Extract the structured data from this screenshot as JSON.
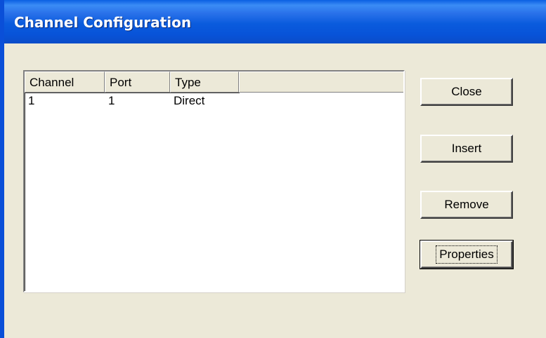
{
  "window": {
    "title": "Channel Configuration"
  },
  "list": {
    "columns": [
      "Channel",
      "Port",
      "Type"
    ],
    "rows": [
      {
        "channel": "1",
        "port": "1",
        "type": "Direct"
      }
    ]
  },
  "buttons": {
    "close": "Close",
    "insert": "Insert",
    "remove": "Remove",
    "properties": "Properties"
  },
  "colors": {
    "titlebar": "#0a5bdd",
    "dialog_background": "#ece9d8"
  }
}
